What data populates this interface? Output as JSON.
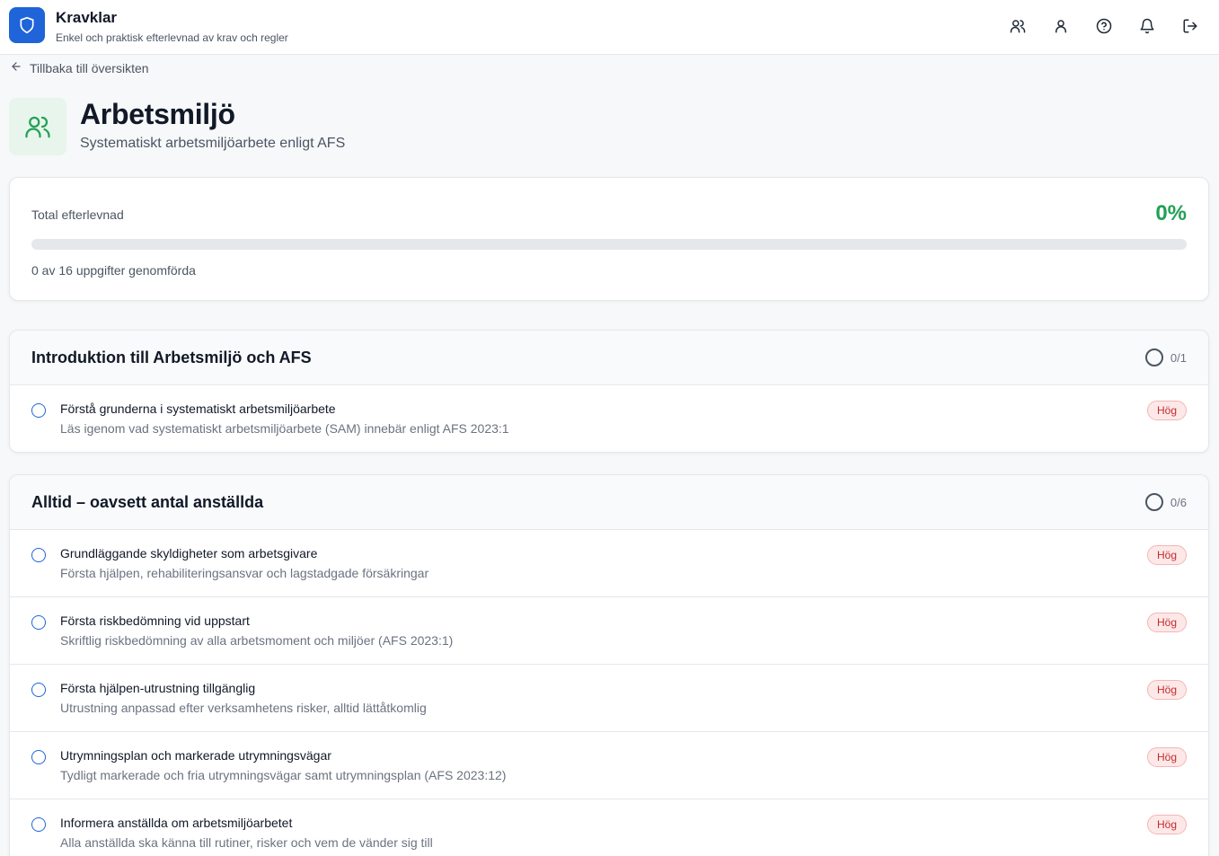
{
  "app": {
    "title": "Kravklar",
    "subtitle": "Enkel och praktisk efterlevnad av krav och regler",
    "icons": [
      "users-icon",
      "user-icon",
      "help-icon",
      "bell-icon",
      "logout-icon"
    ]
  },
  "nav": {
    "back_label": "Tillbaka till översikten"
  },
  "page": {
    "title": "Arbetsmiljö",
    "subtitle": "Systematiskt arbetsmiljöarbete enligt AFS",
    "icon": "users-icon"
  },
  "progress": {
    "label": "Total efterlevnad",
    "percent_text": "0%",
    "fraction": 0,
    "count_text": "0 av 16 uppgifter genomförda"
  },
  "sections": [
    {
      "title": "Introduktion till Arbetsmiljö och AFS",
      "progress": "0/1",
      "tasks": [
        {
          "title": "Förstå grunderna i systematiskt arbetsmiljöarbete",
          "desc": "Läs igenom vad systematiskt arbetsmiljöarbete (SAM) innebär enligt AFS 2023:1",
          "priority": "Hög"
        }
      ]
    },
    {
      "title": "Alltid – oavsett antal anställda",
      "progress": "0/6",
      "tasks": [
        {
          "title": "Grundläggande skyldigheter som arbetsgivare",
          "desc": "Första hjälpen, rehabiliteringsansvar och lagstadgade försäkringar",
          "priority": "Hög"
        },
        {
          "title": "Första riskbedömning vid uppstart",
          "desc": "Skriftlig riskbedömning av alla arbetsmoment och miljöer (AFS 2023:1)",
          "priority": "Hög"
        },
        {
          "title": "Första hjälpen-utrustning tillgänglig",
          "desc": "Utrustning anpassad efter verksamhetens risker, alltid lättåtkomlig",
          "priority": "Hög"
        },
        {
          "title": "Utrymningsplan och markerade utrymningsvägar",
          "desc": "Tydligt markerade och fria utrymningsvägar samt utrymningsplan (AFS 2023:12)",
          "priority": "Hög"
        },
        {
          "title": "Informera anställda om arbetsmiljöarbetet",
          "desc": "Alla anställda ska känna till rutiner, risker och vem de vänder sig till",
          "priority": "Hög"
        }
      ]
    }
  ],
  "colors": {
    "brand": "#1f64d8",
    "success": "#22a055",
    "priority_high": "#c42b2b"
  }
}
